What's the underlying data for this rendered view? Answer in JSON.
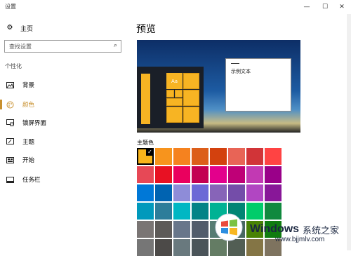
{
  "window": {
    "title": "设置",
    "minimize": "—",
    "maximize": "☐",
    "close": "✕"
  },
  "sidebar": {
    "home_label": "主页",
    "search_placeholder": "查找设置",
    "section_label": "个性化",
    "items": [
      {
        "label": "背景",
        "icon": "picture-icon"
      },
      {
        "label": "颜色",
        "icon": "palette-icon",
        "active": true
      },
      {
        "label": "锁屏界面",
        "icon": "lock-screen-icon"
      },
      {
        "label": "主题",
        "icon": "theme-icon"
      },
      {
        "label": "开始",
        "icon": "start-icon"
      },
      {
        "label": "任务栏",
        "icon": "taskbar-icon"
      }
    ]
  },
  "main": {
    "title": "预览",
    "preview": {
      "tile_text": "Aa",
      "sample_text": "示例文本"
    },
    "swatch_label": "主题色",
    "swatches": [
      [
        "#f8b41b",
        "#f7941d",
        "#f5821f",
        "#dc5e1a",
        "#d3410e",
        "#e86456",
        "#d13438",
        "#ff4343"
      ],
      [
        "#e74856",
        "#e81123",
        "#ea005e",
        "#c30052",
        "#e3008c",
        "#bf0077",
        "#c239b3",
        "#9a0089"
      ],
      [
        "#0078d7",
        "#0063b1",
        "#8e8cd8",
        "#6b69d6",
        "#8764b8",
        "#744da9",
        "#b146c2",
        "#881798"
      ],
      [
        "#0099bc",
        "#2d7d9a",
        "#00b7c3",
        "#038387",
        "#00b294",
        "#018574",
        "#00cc6a",
        "#10893e"
      ],
      [
        "#7a7574",
        "#5d5a58",
        "#68768a",
        "#515c6b",
        "#567c73",
        "#486860",
        "#498205",
        "#107c10"
      ],
      [
        "#767676",
        "#4c4a48",
        "#69797e",
        "#4a5459",
        "#647c64",
        "#525e54",
        "#847545",
        "#7e735f"
      ]
    ]
  },
  "watermark": {
    "brand": "Windows",
    "tagline": "系统之家",
    "url": "www.bjjmlv.com"
  }
}
